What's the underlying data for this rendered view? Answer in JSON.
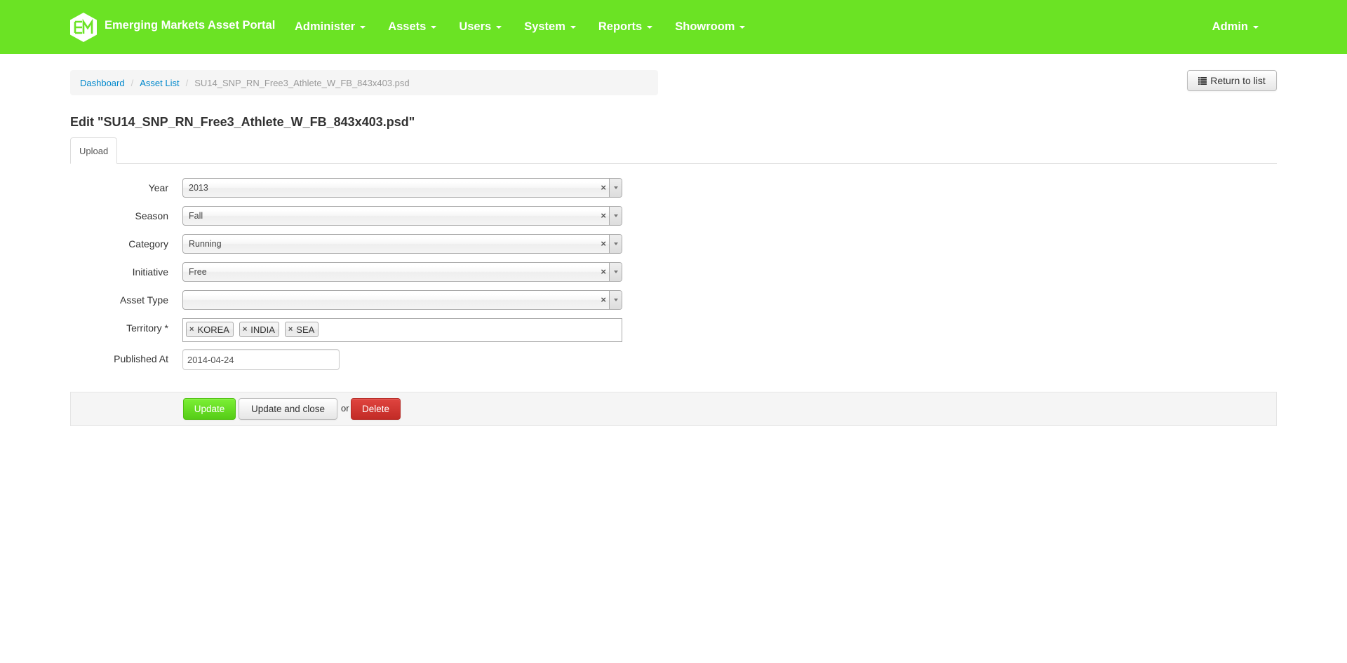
{
  "colors": {
    "navbar": "#6be324",
    "link": "#0088cc",
    "update_button": "#5ed61e",
    "delete_button": "#d33a35"
  },
  "navbar": {
    "brand": "Emerging Markets Asset Portal",
    "items": [
      {
        "label": "Administer"
      },
      {
        "label": "Assets"
      },
      {
        "label": "Users"
      },
      {
        "label": "System"
      },
      {
        "label": "Reports"
      },
      {
        "label": "Showroom"
      }
    ],
    "user_menu": "Admin"
  },
  "breadcrumb": {
    "items": [
      "Dashboard",
      "Asset List"
    ],
    "current": "SU14_SNP_RN_Free3_Athlete_W_FB_843x403.psd"
  },
  "return_button": "Return to list",
  "page_title": "Edit \"SU14_SNP_RN_Free3_Athlete_W_FB_843x403.psd\"",
  "tabs": [
    "Upload"
  ],
  "form": {
    "year": {
      "label": "Year",
      "value": "2013"
    },
    "season": {
      "label": "Season",
      "value": "Fall"
    },
    "category": {
      "label": "Category",
      "value": "Running"
    },
    "initiative": {
      "label": "Initiative",
      "value": "Free"
    },
    "asset_type": {
      "label": "Asset Type",
      "value": ""
    },
    "territory": {
      "label": "Territory *",
      "tokens": [
        "KOREA",
        "INDIA",
        "SEA"
      ]
    },
    "published_at": {
      "label": "Published At",
      "value": "2014-04-24"
    }
  },
  "actions": {
    "update": "Update",
    "update_close": "Update and close",
    "or": "or",
    "delete": "Delete"
  }
}
